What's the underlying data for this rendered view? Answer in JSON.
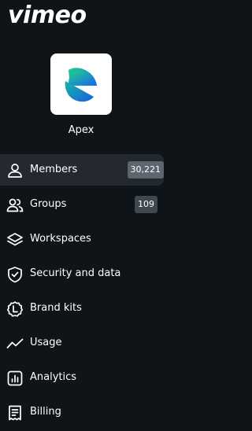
{
  "brand": {
    "logo_text": "vimeo"
  },
  "org": {
    "name": "Apex"
  },
  "nav": {
    "items": [
      {
        "label": "Members",
        "count": "30,221",
        "icon": "person-icon",
        "active": true
      },
      {
        "label": "Groups",
        "count": "109",
        "icon": "group-icon"
      },
      {
        "label": "Workspaces",
        "icon": "layers-icon"
      },
      {
        "label": "Security and data",
        "icon": "shield-check-icon"
      },
      {
        "label": "Brand kits",
        "icon": "brand-kit-icon"
      },
      {
        "label": "Usage",
        "icon": "trend-line-icon"
      },
      {
        "label": "Analytics",
        "icon": "bar-chart-icon"
      },
      {
        "label": "Billing",
        "icon": "receipt-icon"
      }
    ]
  },
  "colors": {
    "background": "#0f1418",
    "active_item": "#23292f",
    "badge": "#5d666f",
    "logo_gradient_start": "#18c37a",
    "logo_gradient_end": "#1a67e6"
  }
}
